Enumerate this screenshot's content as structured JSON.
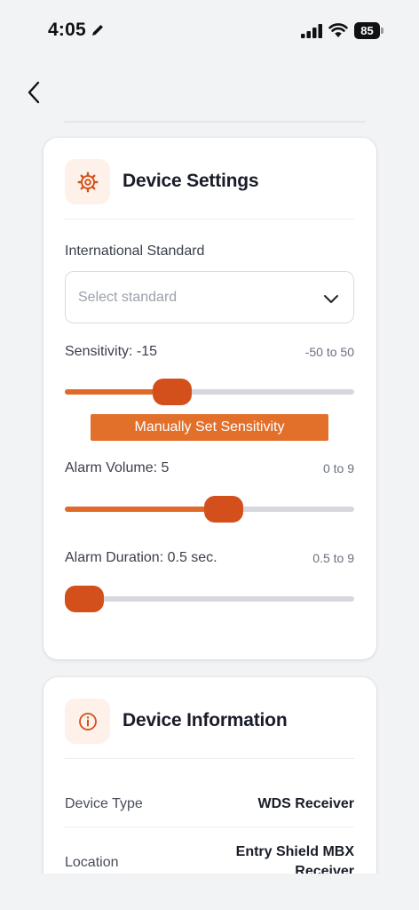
{
  "status_bar": {
    "time": "4:05",
    "battery": "85"
  },
  "colors": {
    "accent": "#e06a28",
    "thumb": "#d3501c",
    "icon_bg": "#fdf1e9"
  },
  "icons": {
    "back": "chevron-left-icon",
    "settings": "gear-icon",
    "info": "info-icon",
    "select": "chevron-down-icon"
  },
  "settings_card": {
    "title": "Device Settings",
    "standard": {
      "label": "International Standard",
      "placeholder": "Select standard"
    },
    "sensitivity": {
      "label": "Sensitivity: -15",
      "range": "-50 to 50",
      "value": -15,
      "min": -50,
      "max": 50,
      "button_label": "Manually Set Sensitivity"
    },
    "alarm_volume": {
      "label": "Alarm Volume: 5",
      "range": "0 to 9",
      "value": 5,
      "min": 0,
      "max": 9
    },
    "alarm_duration": {
      "label": "Alarm Duration: 0.5 sec.",
      "range": "0.5 to 9",
      "value": 0.5,
      "min": 0.5,
      "max": 9
    }
  },
  "info_card": {
    "title": "Device Information",
    "rows": [
      {
        "label": "Device Type",
        "value": "WDS Receiver"
      },
      {
        "label": "Location",
        "value": "Entry Shield MBX Receiver"
      }
    ]
  }
}
